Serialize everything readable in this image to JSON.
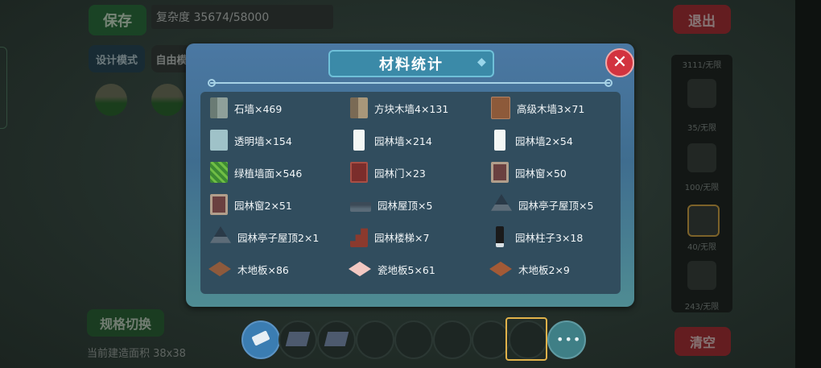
{
  "topbar": {
    "save_label": "保存",
    "complexity_text": "复杂度 35674/58000",
    "exit_label": "退出"
  },
  "mode": {
    "design_label": "设计模式",
    "free_label": "自由模"
  },
  "bottom": {
    "spec_label": "规格切换",
    "area_text": "当前建造面积 38x38",
    "clear_label": "清空"
  },
  "right_panel": {
    "counts": [
      "3111/无限",
      "35/无限",
      "100/无限",
      "40/无限",
      "243/无限"
    ]
  },
  "modal": {
    "title": "材料统计",
    "close_icon": "close-icon",
    "items": [
      {
        "label": "石墙×469",
        "icon": "stone-wall-icon"
      },
      {
        "label": "方块木墙4×131",
        "icon": "block-wood-wall-icon"
      },
      {
        "label": "高级木墙3×71",
        "icon": "advanced-wood-wall-icon"
      },
      {
        "label": "透明墙×154",
        "icon": "transparent-wall-icon"
      },
      {
        "label": "园林墙×214",
        "icon": "garden-wall-icon"
      },
      {
        "label": "园林墙2×54",
        "icon": "garden-wall-2-icon"
      },
      {
        "label": "绿植墙面×546",
        "icon": "green-plant-wall-icon"
      },
      {
        "label": "园林门×23",
        "icon": "garden-door-icon"
      },
      {
        "label": "园林窗×50",
        "icon": "garden-window-icon"
      },
      {
        "label": "园林窗2×51",
        "icon": "garden-window-2-icon"
      },
      {
        "label": "园林屋顶×5",
        "icon": "garden-roof-icon"
      },
      {
        "label": "园林亭子屋顶×5",
        "icon": "pavilion-roof-icon"
      },
      {
        "label": "园林亭子屋顶2×1",
        "icon": "pavilion-roof-2-icon"
      },
      {
        "label": "园林楼梯×7",
        "icon": "garden-stairs-icon"
      },
      {
        "label": "园林柱子3×18",
        "icon": "garden-pillar-icon"
      },
      {
        "label": "木地板×86",
        "icon": "wood-floor-icon"
      },
      {
        "label": "瓷地板5×61",
        "icon": "tile-floor-icon"
      },
      {
        "label": "木地板2×9",
        "icon": "wood-floor-2-icon"
      }
    ]
  }
}
